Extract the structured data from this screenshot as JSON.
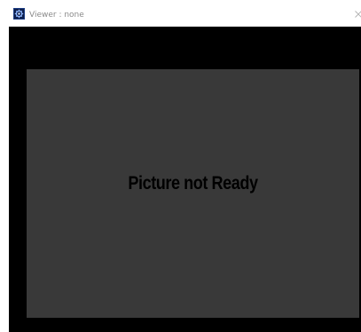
{
  "window": {
    "title": "Viewer : none",
    "app_icon": "gear-icon",
    "close_icon": "close-icon"
  },
  "viewer": {
    "message": "Picture not Ready"
  },
  "colors": {
    "viewer_background": "#000000",
    "placeholder_background": "#393939",
    "message_text": "#000000",
    "title_text": "#8a8a8a"
  }
}
